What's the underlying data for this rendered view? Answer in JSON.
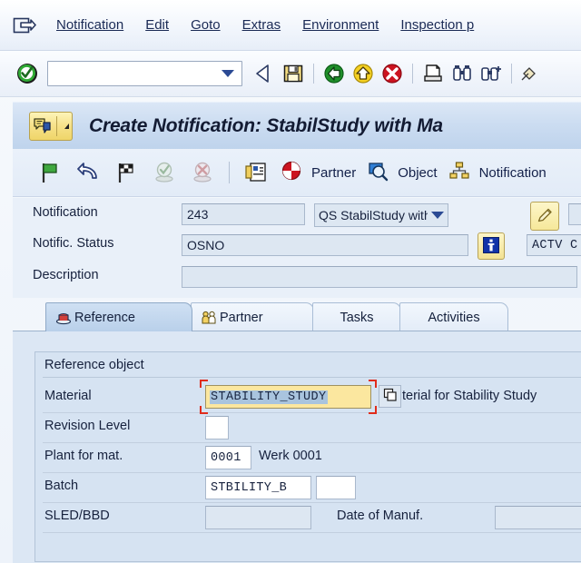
{
  "menu": {
    "system_icon": "system-menu-icon",
    "items": [
      {
        "label": "Notification",
        "accel": "N"
      },
      {
        "label": "Edit",
        "accel": "E"
      },
      {
        "label": "Goto",
        "accel": "G"
      },
      {
        "label": "Extras",
        "accel": "a"
      },
      {
        "label": "Environment",
        "accel": "v"
      },
      {
        "label": "Inspection p",
        "accel": "p"
      }
    ]
  },
  "toolbar": {
    "enter_icon": "green-check-enter-icon",
    "command_value": "",
    "command_placeholder": "",
    "dropdown_icon": "chevron-down-icon",
    "icons": [
      "back-arrow-icon",
      "save-floppy-icon",
      "back-green-icon",
      "exit-yellow-icon",
      "cancel-red-icon",
      "print-icon",
      "find-icon",
      "find-next-icon",
      "help-icon"
    ]
  },
  "title": {
    "icon": "notification-create-icon",
    "menu_arrow_icon": "dropdown-arrow-icon",
    "text": "Create Notification: StabilStudy with Ma"
  },
  "apptoolbar": {
    "icons": [
      "green-flag-icon",
      "undo-arrow-icon",
      "checkered-flag-icon",
      "complete-stamp-icon",
      "cancel-stamp-icon",
      "address-card-icon"
    ],
    "buttons": [
      {
        "label": "Partner",
        "icon": "partner-circle-icon"
      },
      {
        "label": "Object",
        "icon": "object-magnifier-icon"
      },
      {
        "label": "Notification",
        "icon": "notification-hierarchy-icon"
      }
    ]
  },
  "header": {
    "notification_label": "Notification",
    "notification_value": "243",
    "notification_type": "QS StabilStudy with ...",
    "pencil_icon": "pencil-edit-icon",
    "status_label": "Notific. Status",
    "status_value": "OSNO",
    "info_icon": "info-icon",
    "status_detail": "ACTV C",
    "description_label": "Description",
    "description_value": ""
  },
  "tabs": [
    {
      "label": "Reference",
      "icon": "reference-object-icon",
      "active": true
    },
    {
      "label": "Partner",
      "icon": "partner-people-icon",
      "active": false
    },
    {
      "label": "Tasks",
      "icon": "",
      "active": false
    },
    {
      "label": "Activities",
      "icon": "",
      "active": false
    }
  ],
  "reference_object": {
    "group_title": "Reference object",
    "material_label": "Material",
    "material_value": "STABILITY_STUDY",
    "material_matchcode_icon": "matchcode-overlay-icon",
    "material_description": "terial for Stability Study",
    "revision_label": "Revision Level",
    "revision_value": "",
    "plant_label": "Plant for mat.",
    "plant_value": "0001",
    "plant_description": "Werk 0001",
    "batch_label": "Batch",
    "batch_value": "STBILITY_B",
    "batch_extra_value": "",
    "sled_label": "SLED/BBD",
    "sled_value": "",
    "manuf_label": "Date of Manuf.",
    "manuf_value": ""
  },
  "colors": {
    "focus_marker": "#e02c1c",
    "input_focus_bg": "#fbe79f",
    "selection_bg": "#a9c4de",
    "window_bg": "#e9f0f9",
    "tab_active_bg": "#c4d8ef"
  }
}
